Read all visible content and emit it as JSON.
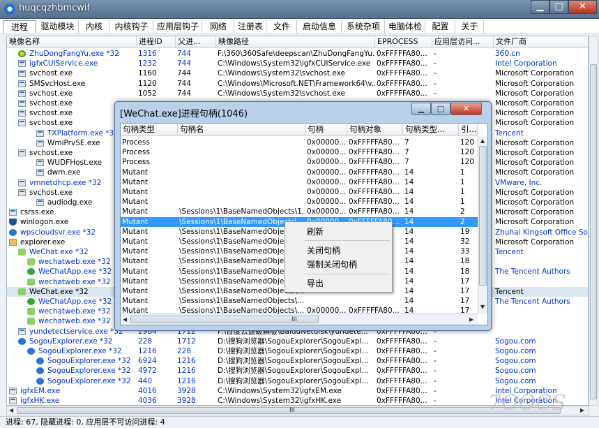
{
  "window": {
    "title": "huqcqzhbmcwif",
    "min": "▁",
    "max": "□",
    "close": "✕"
  },
  "tabs": [
    "进程",
    "驱动模块",
    "内核",
    "内核钩子",
    "应用层钩子",
    "网络",
    "注册表",
    "文件",
    "启动信息",
    "系统杂项",
    "电脑体检",
    "配置",
    "关于"
  ],
  "columns": [
    "映像名称",
    "进程ID",
    "父进...",
    "映像路径",
    "EPROCESS",
    "应用层访问...",
    "文件厂商"
  ],
  "processes": [
    {
      "icon": "circ360",
      "name": "ZhuDongFangYu.exe *32",
      "pid": "1316",
      "ppid": "744",
      "path": "F:\\360\\360Safe\\deepscan\\ZhuDongFangYu....",
      "ep": "0xFFFFFA80...",
      "access": "-",
      "vendor": "360.cn",
      "color": "blue",
      "indent": 1
    },
    {
      "icon": "gen",
      "name": "igfxCUIService.exe",
      "pid": "1232",
      "ppid": "744",
      "path": "C:\\Windows\\System32\\igfxCUIService.exe",
      "ep": "0xFFFFFA80...",
      "access": "-",
      "vendor": "Intel Corporation",
      "color": "blue",
      "indent": 1
    },
    {
      "icon": "gen",
      "name": "svchost.exe",
      "pid": "1160",
      "ppid": "744",
      "path": "C:\\Windows\\System32\\svchost.exe",
      "ep": "0xFFFFFA80...",
      "access": "-",
      "vendor": "Microsoft Corporation",
      "color": "black",
      "indent": 1
    },
    {
      "icon": "gen",
      "name": "SMSvcHost.exe",
      "pid": "1120",
      "ppid": "744",
      "path": "C:\\Windows\\Microsoft.NET\\Framework64\\v...",
      "ep": "0xFFFFFA80...",
      "access": "-",
      "vendor": "Microsoft Corporation",
      "color": "black",
      "indent": 1
    },
    {
      "icon": "gen",
      "name": "svchost.exe",
      "pid": "1052",
      "ppid": "744",
      "path": "C:\\Windows\\System32\\svchost.exe",
      "ep": "0xFFFFFA80...",
      "access": "-",
      "vendor": "Microsoft Corporation",
      "color": "black",
      "indent": 1
    },
    {
      "icon": "gen",
      "name": "svchost.exe",
      "pid": "",
      "ppid": "",
      "path": "",
      "ep": "",
      "access": "",
      "vendor": "Microsoft Corporation",
      "color": "black",
      "indent": 1
    },
    {
      "icon": "gen",
      "name": "svchost.exe",
      "pid": "",
      "ppid": "",
      "path": "",
      "ep": "",
      "access": "",
      "vendor": "Microsoft Corporation",
      "color": "black",
      "indent": 1
    },
    {
      "icon": "gen",
      "name": "svchost.exe",
      "pid": "",
      "ppid": "",
      "path": "",
      "ep": "",
      "access": "",
      "vendor": "Microsoft Corporation",
      "color": "black",
      "indent": 1
    },
    {
      "icon": "gen",
      "name": "TXPlatform.exe *32",
      "pid": "",
      "ppid": "",
      "path": "",
      "ep": "",
      "access": "",
      "vendor": "Tencent",
      "color": "blue",
      "indent": 3
    },
    {
      "icon": "gen",
      "name": "WmiPrvSE.exe",
      "pid": "",
      "ppid": "",
      "path": "",
      "ep": "",
      "access": "",
      "vendor": "Microsoft Corporation",
      "color": "black",
      "indent": 3
    },
    {
      "icon": "gen",
      "name": "svchost.exe",
      "pid": "",
      "ppid": "",
      "path": "",
      "ep": "",
      "access": "",
      "vendor": "Microsoft Corporation",
      "color": "black",
      "indent": 1
    },
    {
      "icon": "gen",
      "name": "WUDFHost.exe",
      "pid": "",
      "ppid": "",
      "path": "",
      "ep": "",
      "access": "",
      "vendor": "Microsoft Corporation",
      "color": "black",
      "indent": 3
    },
    {
      "icon": "gen",
      "name": "dwm.exe",
      "pid": "",
      "ppid": "",
      "path": "",
      "ep": "",
      "access": "",
      "vendor": "Microsoft Corporation",
      "color": "black",
      "indent": 3
    },
    {
      "icon": "gen",
      "name": "vmnetdhcp.exe *32",
      "pid": "",
      "ppid": "",
      "path": "",
      "ep": "",
      "access": "",
      "vendor": "VMware, Inc.",
      "color": "blue",
      "indent": 1
    },
    {
      "icon": "gen",
      "name": "svchost.exe",
      "pid": "",
      "ppid": "",
      "path": "",
      "ep": "",
      "access": "",
      "vendor": "Microsoft Corporation",
      "color": "black",
      "indent": 1
    },
    {
      "icon": "gen",
      "name": "audiodg.exe",
      "pid": "",
      "ppid": "",
      "path": "",
      "ep": "",
      "access": "",
      "vendor": "Microsoft Corporation",
      "color": "black",
      "indent": 3
    },
    {
      "icon": "gen",
      "name": "csrss.exe",
      "pid": "",
      "ppid": "",
      "path": "",
      "ep": "",
      "access": "",
      "vendor": "Microsoft Corporation",
      "color": "black",
      "indent": 0
    },
    {
      "icon": "shield",
      "name": "winlogon.exe",
      "pid": "",
      "ppid": "",
      "path": "",
      "ep": "",
      "access": "",
      "vendor": "Microsoft Corporation",
      "color": "black",
      "indent": 0
    },
    {
      "icon": "blue",
      "name": "wpscloudsvr.exe *32",
      "pid": "",
      "ppid": "",
      "path": "",
      "ep": "",
      "access": "",
      "vendor": "Zhuhai Kingsoft Office Software",
      "color": "blue",
      "indent": 0
    },
    {
      "icon": "folder",
      "name": "explorer.exe",
      "pid": "",
      "ppid": "",
      "path": "",
      "ep": "",
      "access": "",
      "vendor": "Microsoft Corporation",
      "color": "black",
      "indent": 0
    },
    {
      "icon": "wx",
      "name": "WeChat.exe *32",
      "pid": "",
      "ppid": "",
      "path": "",
      "ep": "",
      "access": "",
      "vendor": "Tencent",
      "color": "blue",
      "indent": 1
    },
    {
      "icon": "wx",
      "name": "wechatweb.exe *32",
      "pid": "",
      "ppid": "",
      "path": "",
      "ep": "",
      "access": "",
      "vendor": "",
      "color": "blue",
      "indent": 2
    },
    {
      "icon": "green",
      "name": "WeChatApp.exe *32",
      "pid": "",
      "ppid": "",
      "path": "",
      "ep": "",
      "access": "",
      "vendor": "The Tencent Authors",
      "color": "blue",
      "indent": 2
    },
    {
      "icon": "wx",
      "name": "wechatweb.exe *32",
      "pid": "",
      "ppid": "",
      "path": "",
      "ep": "",
      "access": "",
      "vendor": "",
      "color": "blue",
      "indent": 2
    },
    {
      "icon": "wx",
      "name": "WeChat.exe *32",
      "pid": "",
      "ppid": "",
      "path": "",
      "ep": "",
      "access": "",
      "vendor": "Tencent",
      "color": "black",
      "indent": 1,
      "selected": true
    },
    {
      "icon": "green",
      "name": "WeChatApp.exe *32",
      "pid": "",
      "ppid": "",
      "path": "",
      "ep": "",
      "access": "",
      "vendor": "The Tencent Authors",
      "color": "blue",
      "indent": 2
    },
    {
      "icon": "wx",
      "name": "wechatweb.exe *32",
      "pid": "",
      "ppid": "",
      "path": "",
      "ep": "",
      "access": "",
      "vendor": "",
      "color": "blue",
      "indent": 2
    },
    {
      "icon": "wx",
      "name": "wechatweb.exe *32",
      "pid": "",
      "ppid": "",
      "path": "",
      "ep": "",
      "access": "",
      "vendor": "",
      "color": "blue",
      "indent": 2
    },
    {
      "icon": "gen",
      "name": "yundetectservice.exe *32",
      "pid": "2984",
      "ppid": "1712",
      "path": "F:\\百度云盘破解版\\BaiduNetdisk\\yundete...",
      "ep": "0xFFFFFA80...",
      "access": "-",
      "vendor": "",
      "color": "blue",
      "indent": 1
    },
    {
      "icon": "blue",
      "name": "SogouExplorer.exe *32",
      "pid": "228",
      "ppid": "1712",
      "path": "D:\\搜狗浏览器\\SogouExplorer\\SogouExpl...",
      "ep": "0xFFFFFA80...",
      "access": "-",
      "vendor": "Sogou.com",
      "color": "blue",
      "indent": 1
    },
    {
      "icon": "blue",
      "name": "SogouExplorer.exe *32",
      "pid": "1216",
      "ppid": "228",
      "path": "D:\\搜狗浏览器\\SogouExplorer\\SogouExpl...",
      "ep": "0xFFFFFA80...",
      "access": "-",
      "vendor": "Sogou.com",
      "color": "blue",
      "indent": 2
    },
    {
      "icon": "blue",
      "name": "SogouExplorer.exe *32",
      "pid": "6924",
      "ppid": "1216",
      "path": "D:\\搜狗浏览器\\SogouExplorer\\SogouExpl...",
      "ep": "0xFFFFFA80...",
      "access": "-",
      "vendor": "Sogou.com",
      "color": "blue",
      "indent": 3
    },
    {
      "icon": "blue",
      "name": "SogouExplorer.exe *32",
      "pid": "4972",
      "ppid": "1216",
      "path": "D:\\搜狗浏览器\\SogouExplorer\\SogouExpl...",
      "ep": "0xFFFFFA80...",
      "access": "-",
      "vendor": "Sogou.com",
      "color": "blue",
      "indent": 3
    },
    {
      "icon": "blue",
      "name": "SogouExplorer.exe *32",
      "pid": "440",
      "ppid": "1216",
      "path": "D:\\搜狗浏览器\\SogouExplorer\\SogouExpl...",
      "ep": "0xFFFFFA80...",
      "access": "-",
      "vendor": "Sogou.com",
      "color": "blue",
      "indent": 3
    },
    {
      "icon": "gen",
      "name": "igfxEM.exe",
      "pid": "4016",
      "ppid": "3928",
      "path": "C:\\Windows\\System32\\igfxEM.exe",
      "ep": "0xFFFFFA80...",
      "access": "-",
      "vendor": "Intel Corporation",
      "color": "blue",
      "indent": 0
    },
    {
      "icon": "gen",
      "name": "igfxHK.exe",
      "pid": "4036",
      "ppid": "3928",
      "path": "C:\\Windows\\System32\\igfxHK.exe",
      "ep": "0xFFFFFA80...",
      "access": "-",
      "vendor": "Intel Corporation",
      "color": "blue",
      "indent": 0
    }
  ],
  "status": "进程: 67, 隐藏进程: 0, 应用层不可访问进程: 4",
  "dialog": {
    "title": "[WeChat.exe]进程句柄(1046)",
    "columns": [
      "句柄类型",
      "句柄名",
      "句柄",
      "句柄对象",
      "句柄类型...",
      "引..."
    ],
    "rows": [
      [
        "Process",
        "",
        "0x00000...",
        "0xFFFFFA80...",
        "7",
        "120"
      ],
      [
        "Process",
        "",
        "0x00000...",
        "0xFFFFFA80...",
        "7",
        "120"
      ],
      [
        "Process",
        "",
        "0x00000...",
        "0xFFFFFA80...",
        "7",
        "120"
      ],
      [
        "Mutant",
        "",
        "0x00000...",
        "0xFFFFFA80...",
        "14",
        "1"
      ],
      [
        "Mutant",
        "",
        "0x00000...",
        "0xFFFFFA80...",
        "14",
        "1"
      ],
      [
        "Mutant",
        "",
        "0x00000...",
        "0xFFFFFA80...",
        "14",
        "1"
      ],
      [
        "Mutant",
        "",
        "0x00000...",
        "0xFFFFFA80...",
        "14",
        "1"
      ],
      [
        "Mutant",
        "\\Sessions\\1\\BaseNamedObjects\\1...",
        "0x00000...",
        "0xFFFFFA80...",
        "14",
        "2"
      ],
      [
        "Mutant",
        "\\Sessions\\1\\BaseNamedObjects\\...",
        "0x00000...",
        "0xFFFFFA80...",
        "14",
        "2"
      ],
      [
        "Mutant",
        "\\Sessions\\1\\BaseNamedObjects\\...",
        "",
        "",
        "14",
        "19"
      ],
      [
        "Mutant",
        "\\Sessions\\1\\BaseNamedObjects\\...",
        "",
        "",
        "14",
        "32"
      ],
      [
        "Mutant",
        "\\Sessions\\1\\BaseNamedObjects\\...",
        "",
        "",
        "14",
        "33"
      ],
      [
        "Mutant",
        "\\Sessions\\1\\BaseNamedObjects\\...",
        "",
        "",
        "14",
        "18"
      ],
      [
        "Mutant",
        "\\Sessions\\1\\BaseNamedObjects\\...",
        "",
        "",
        "14",
        "18"
      ],
      [
        "Mutant",
        "\\Sessions\\1\\BaseNamedObjects\\...",
        "",
        "",
        "14",
        "17"
      ],
      [
        "Mutant",
        "\\Sessions\\1\\BaseNamedObjects\\...",
        "",
        "",
        "14",
        "17"
      ],
      [
        "Mutant",
        "\\Sessions\\1\\BaseNamedObjects\\...",
        "",
        "",
        "14",
        "17"
      ],
      [
        "Mutant",
        "\\Sessions\\1\\BaseNamedObjects\\...",
        "0x00000...",
        "0xFFFFFA80...",
        "14",
        "17"
      ]
    ],
    "selected_row": 8,
    "hscroll_center": "III"
  },
  "context_menu": [
    "刷新",
    "关闭句柄",
    "强制关闭句柄",
    "导出"
  ],
  "main_hscroll_center": "III",
  "watermark": "7OOCS"
}
